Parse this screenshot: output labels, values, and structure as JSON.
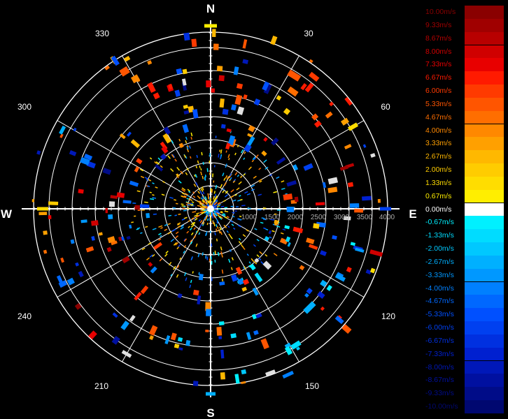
{
  "chart_data": {
    "type": "polar-velocity-display",
    "cardinal": {
      "north": "N",
      "east": "E",
      "south": "S",
      "west": "W"
    },
    "angle_labels": [
      "30",
      "60",
      "120",
      "150",
      "210",
      "240",
      "300",
      "330"
    ],
    "range_labels": [
      "1000",
      "1500",
      "2000",
      "2500",
      "3000",
      "3500",
      "4000"
    ],
    "color_scale": [
      {
        "label": "10.00m/s",
        "color": "#8a0000"
      },
      {
        "label": "9.33m/s",
        "color": "#a00000"
      },
      {
        "label": "8.67m/s",
        "color": "#b80000"
      },
      {
        "label": "8.00m/s",
        "color": "#d00000"
      },
      {
        "label": "7.33m/s",
        "color": "#e80000"
      },
      {
        "label": "6.67m/s",
        "color": "#ff1a00"
      },
      {
        "label": "6.00m/s",
        "color": "#ff3a00"
      },
      {
        "label": "5.33m/s",
        "color": "#ff5500"
      },
      {
        "label": "4.67m/s",
        "color": "#ff6e00"
      },
      {
        "label": "4.00m/s",
        "color": "#ff8800"
      },
      {
        "label": "3.33m/s",
        "color": "#ffa000"
      },
      {
        "label": "2.67m/s",
        "color": "#ffb800"
      },
      {
        "label": "2.00m/s",
        "color": "#ffcc00"
      },
      {
        "label": "1.33m/s",
        "color": "#ffdd00"
      },
      {
        "label": "0.67m/s",
        "color": "#ffee00"
      },
      {
        "label": "0.00m/s",
        "color": "#ffffff"
      },
      {
        "label": "-0.67m/s",
        "color": "#00f0ff"
      },
      {
        "label": "-1.33m/s",
        "color": "#00dcff"
      },
      {
        "label": "-2.00m/s",
        "color": "#00c8ff"
      },
      {
        "label": "-2.67m/s",
        "color": "#00b0ff"
      },
      {
        "label": "-3.33m/s",
        "color": "#0098ff"
      },
      {
        "label": "-4.00m/s",
        "color": "#0080ff"
      },
      {
        "label": "-4.67m/s",
        "color": "#0068ff"
      },
      {
        "label": "-5.33m/s",
        "color": "#0050ff"
      },
      {
        "label": "-6.00m/s",
        "color": "#0040f0"
      },
      {
        "label": "-6.67m/s",
        "color": "#0030e0"
      },
      {
        "label": "-7.33m/s",
        "color": "#0020d0"
      },
      {
        "label": "-8.00m/s",
        "color": "#0018b8"
      },
      {
        "label": "-8.67m/s",
        "color": "#0010a0"
      },
      {
        "label": "-9.33m/s",
        "color": "#000c88"
      },
      {
        "label": "-10.00m/s",
        "color": "#000870"
      }
    ],
    "grid": true
  }
}
